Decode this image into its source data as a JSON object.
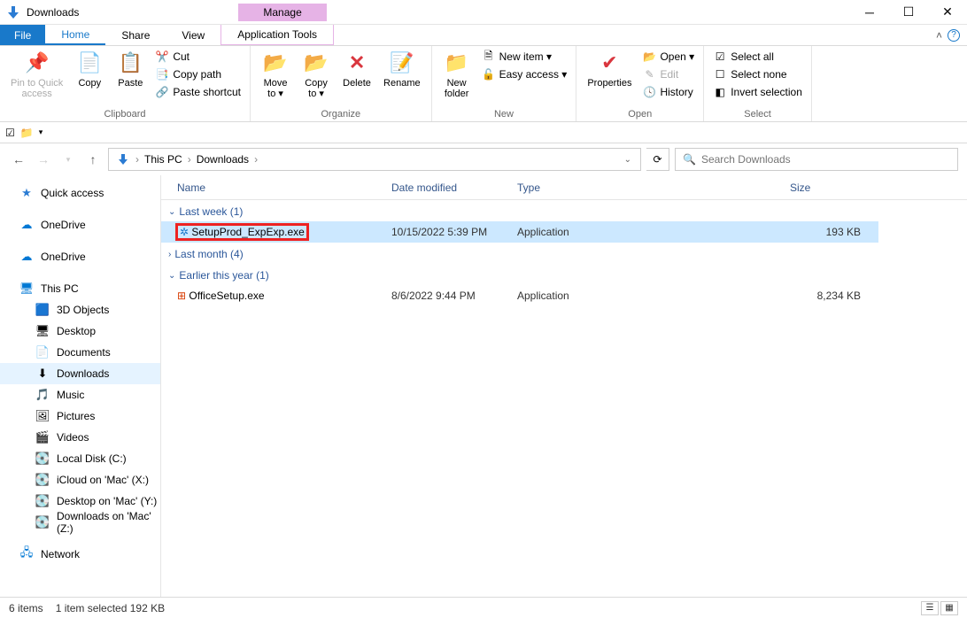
{
  "window": {
    "title": "Downloads",
    "context_tab": "Manage"
  },
  "tabs": {
    "file": "File",
    "home": "Home",
    "share": "Share",
    "view": "View",
    "apptools": "Application Tools"
  },
  "ribbon": {
    "clipboard": {
      "label": "Clipboard",
      "pin": "Pin to Quick\naccess",
      "copy": "Copy",
      "paste": "Paste",
      "cut": "Cut",
      "copypath": "Copy path",
      "pasteshortcut": "Paste shortcut"
    },
    "organize": {
      "label": "Organize",
      "moveto": "Move\nto ▾",
      "copyto": "Copy\nto ▾",
      "delete": "Delete",
      "rename": "Rename"
    },
    "new": {
      "label": "New",
      "newfolder": "New\nfolder",
      "newitem": "New item ▾",
      "easyaccess": "Easy access ▾"
    },
    "open": {
      "label": "Open",
      "properties": "Properties",
      "open": "Open ▾",
      "edit": "Edit",
      "history": "History"
    },
    "select": {
      "label": "Select",
      "all": "Select all",
      "none": "Select none",
      "invert": "Invert selection"
    }
  },
  "breadcrumb": {
    "p1": "This PC",
    "p2": "Downloads"
  },
  "search": {
    "placeholder": "Search Downloads"
  },
  "nav": {
    "quick": "Quick access",
    "od1": "OneDrive",
    "od2": "OneDrive",
    "thispc": "This PC",
    "children": [
      "3D Objects",
      "Desktop",
      "Documents",
      "Downloads",
      "Music",
      "Pictures",
      "Videos",
      "Local Disk (C:)",
      "iCloud on 'Mac' (X:)",
      "Desktop on 'Mac' (Y:)",
      "Downloads on 'Mac' (Z:)"
    ],
    "network": "Network"
  },
  "columns": {
    "name": "Name",
    "date": "Date modified",
    "type": "Type",
    "size": "Size"
  },
  "groups": [
    {
      "label": "Last week (1)",
      "expanded": true,
      "rows": [
        {
          "name": "SetupProd_ExpExp.exe",
          "date": "10/15/2022 5:39 PM",
          "type": "Application",
          "size": "193 KB",
          "selected": true,
          "highlight": true,
          "icon": "app-blue"
        }
      ]
    },
    {
      "label": "Last month (4)",
      "expanded": false,
      "rows": []
    },
    {
      "label": "Earlier this year (1)",
      "expanded": true,
      "rows": [
        {
          "name": "OfficeSetup.exe",
          "date": "8/6/2022 9:44 PM",
          "type": "Application",
          "size": "8,234 KB",
          "selected": false,
          "icon": "office"
        }
      ]
    }
  ],
  "status": {
    "items": "6 items",
    "selection": "1 item selected  192 KB"
  }
}
